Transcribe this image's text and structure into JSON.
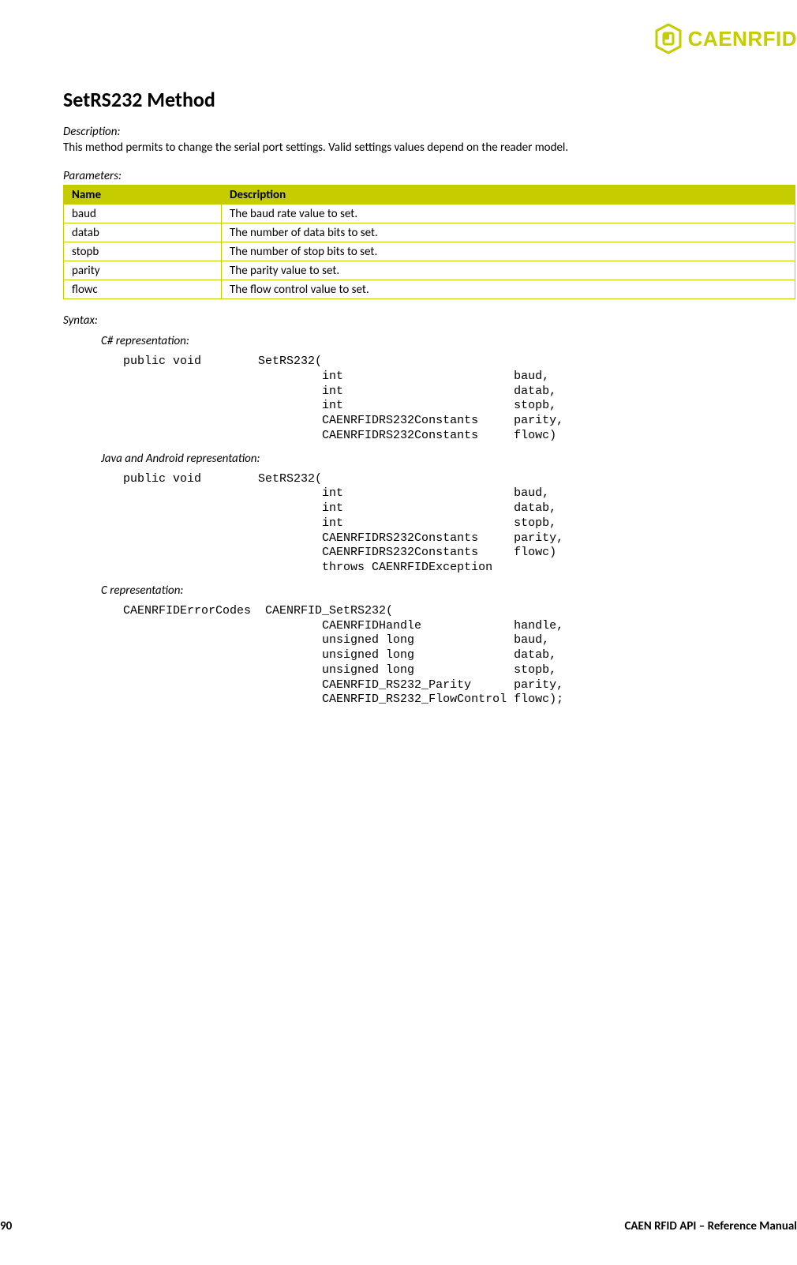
{
  "logo": {
    "brand": "CAENRFID"
  },
  "heading": "SetRS232 Method",
  "description": {
    "label": "Description:",
    "text": "This method permits to change the serial port settings. Valid settings values depend on the reader model."
  },
  "parameters": {
    "label": "Parameters:",
    "headers": {
      "name": "Name",
      "desc": "Description"
    },
    "rows": [
      {
        "name": "baud",
        "desc": "The baud rate value to set."
      },
      {
        "name": "datab",
        "desc": "The number of data bits to set."
      },
      {
        "name": "stopb",
        "desc": "The number of stop bits to set."
      },
      {
        "name": "parity",
        "desc": "The parity value to set."
      },
      {
        "name": "flowc",
        "desc": "The flow control value to set."
      }
    ]
  },
  "syntax": {
    "label": "Syntax:",
    "csharp": {
      "label": "C# representation:",
      "code": "public void        SetRS232(\n                            int                        baud,\n                            int                        datab,\n                            int                        stopb,\n                            CAENRFIDRS232Constants     parity,\n                            CAENRFIDRS232Constants     flowc)"
    },
    "java": {
      "label": "Java and Android representation:",
      "code": "public void        SetRS232(\n                            int                        baud,\n                            int                        datab,\n                            int                        stopb,\n                            CAENRFIDRS232Constants     parity,\n                            CAENRFIDRS232Constants     flowc)\n                            throws CAENRFIDException"
    },
    "c": {
      "label": "C representation:",
      "code": "CAENRFIDErrorCodes  CAENRFID_SetRS232(\n                            CAENRFIDHandle             handle,\n                            unsigned long              baud,\n                            unsigned long              datab,\n                            unsigned long              stopb,\n                            CAENRFID_RS232_Parity      parity,\n                            CAENRFID_RS232_FlowControl flowc);"
    }
  },
  "footer": {
    "page": "90",
    "title": "CAEN RFID API – Reference Manual"
  }
}
